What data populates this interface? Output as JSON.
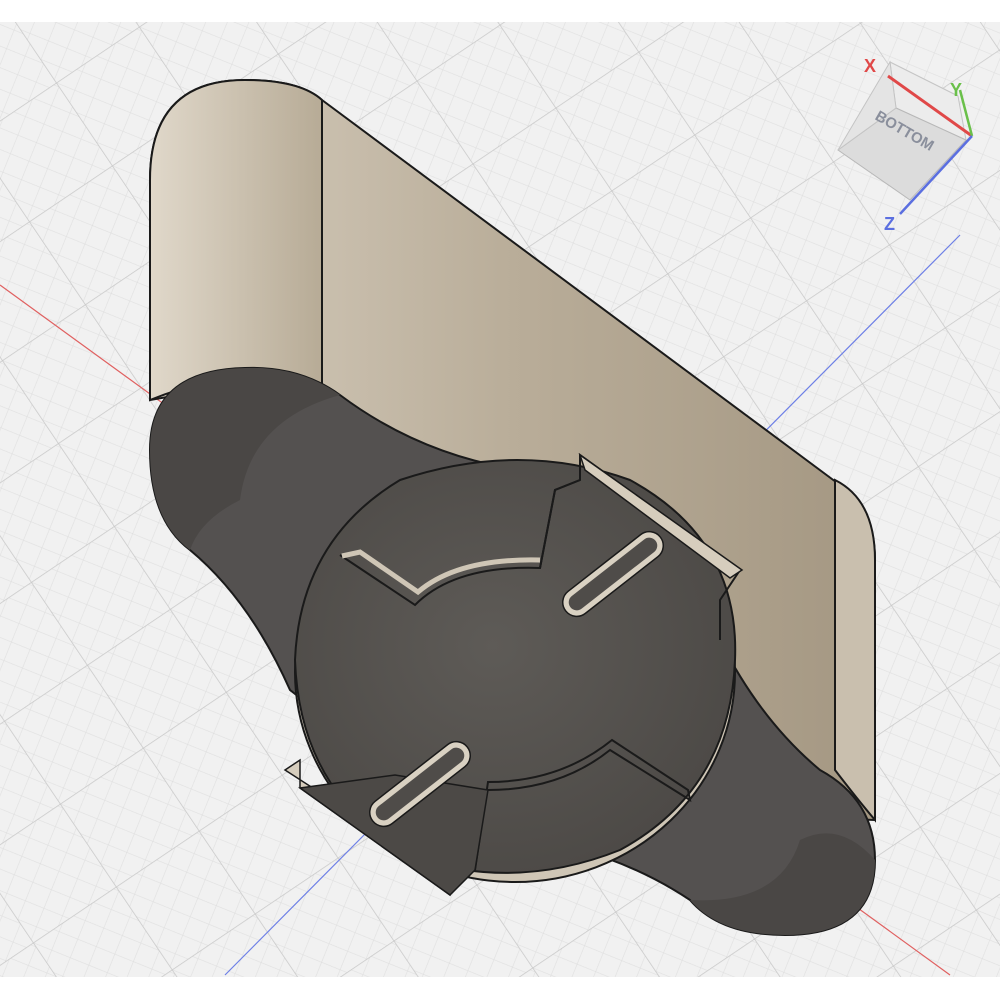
{
  "viewport": {
    "background": "#f1f1f1",
    "grid_minor": "#dcdcdc",
    "grid_major": "#c8c8c8",
    "axis_x_color": "#e06060",
    "axis_z_color": "#6d7fe6"
  },
  "model": {
    "body_color": "#cbc2b3",
    "body_shadow": "#a99d89",
    "knob_color": "#575450",
    "knob_shadow": "#3d3b38",
    "edge_color": "#1a1a1a"
  },
  "view_cube": {
    "face_label": "BOTTOM",
    "axis_x_label": "X",
    "axis_y_label": "Y",
    "axis_z_label": "Z",
    "axis_x_color": "#e04848",
    "axis_y_color": "#6ac04a",
    "axis_z_color": "#5b6fe0"
  }
}
